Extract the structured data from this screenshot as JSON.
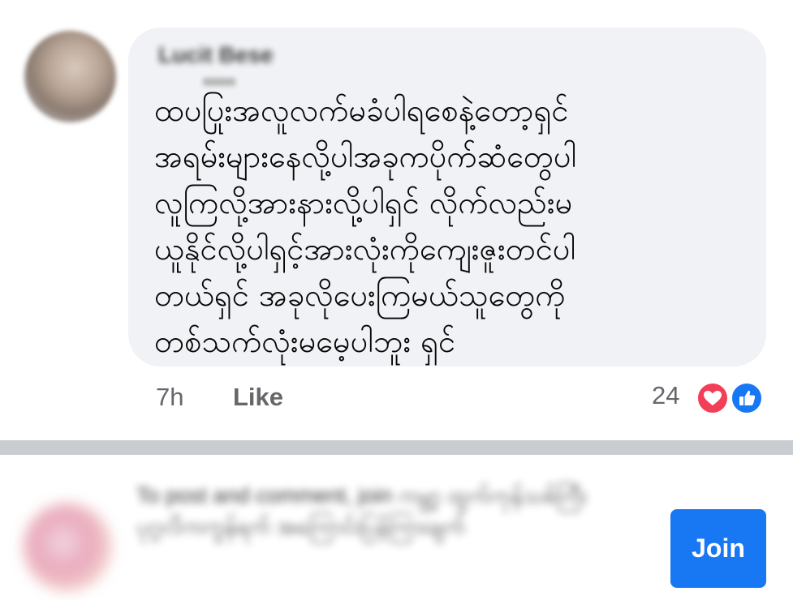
{
  "comment": {
    "author_name": "Lucit Bese",
    "lines": [
      "ထပပြုးအလူလက်မခံပါရစေနဲ့တော့ရှင်",
      "အရမ်းများနေလို့ပါအခုကပိုက်ဆံတွေပါ",
      "လူကြလို့အားနားလို့ပါရှင် လိုက်လည်းမ",
      "ယူနိုင်လို့ပါရှင့်အားလုံးကိုကျေးဇူးတင်ပါ",
      "တယ်ရှင် အခုလိုပေးကြမယ်သူတွေကို",
      "တစ်သက်လုံးမမေ့ပါဘူး ရှင်"
    ],
    "time": "7h",
    "like_label": "Like",
    "reaction_count": "24",
    "reactions": [
      "love-icon",
      "like-icon"
    ],
    "colors": {
      "love": "#f33e58",
      "like": "#1877f2",
      "bubble": "#f0f2f5"
    }
  },
  "join_bar": {
    "prompt": "To post and comment, join ကမ္ဘာ့ ထွက်ကုန်သစ်ကြီး ပုဂ္ဂလိကကွန်ရက် အကြောင်းပြန်ကြားချက်",
    "join_label": "Join",
    "button_color": "#1877f2"
  }
}
